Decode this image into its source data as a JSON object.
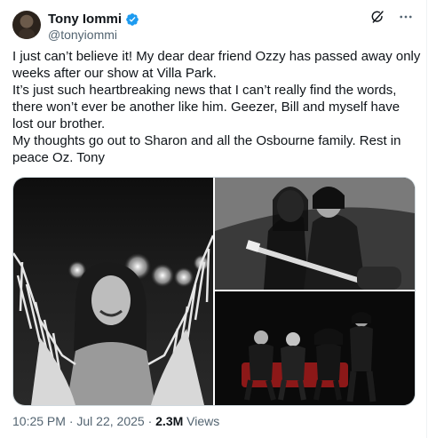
{
  "author": {
    "name": "Tony Iommi",
    "handle": "@tonyiommi"
  },
  "tweet": {
    "text": "I just can’t believe it! My dear dear friend Ozzy has passed away only weeks after our show at Villa Park.\nIt’s just such heartbreaking news that I can’t really find the words, there won’t ever be another like him. Geezer, Bill and myself have lost our brother.\nMy thoughts go out to Sharon and all the Osbourne family. Rest in peace Oz. Tony"
  },
  "media": [
    {
      "icon": "photo-ozzy-on-stage-arms-raised"
    },
    {
      "icon": "photo-ozzy-and-tony-embracing"
    },
    {
      "icon": "photo-black-sabbath-band-seated"
    }
  ],
  "footer": {
    "time": "10:25 PM",
    "date": "Jul 22, 2025",
    "separator": "·",
    "views_count": "2.3M",
    "views_label": "Views"
  },
  "colors": {
    "text_primary": "#0f1419",
    "text_secondary": "#536471",
    "verified_blue": "#1d9bf0",
    "border": "#cfd9de"
  }
}
